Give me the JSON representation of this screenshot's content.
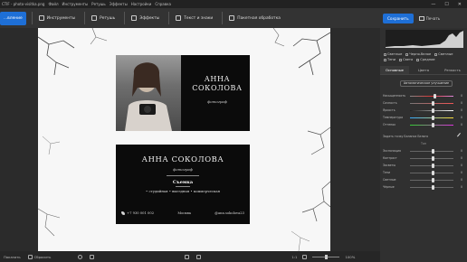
{
  "app": {
    "title": "CTIF - photo-visitka.png",
    "menus": [
      "Файл",
      "Инструменты",
      "Ретушь",
      "Эффекты",
      "Настройки",
      "Справка"
    ],
    "window_controls": [
      "—",
      "☐",
      "✕"
    ]
  },
  "toolbar": {
    "items": [
      {
        "label": "...вление",
        "icon": "adjust-icon",
        "active": true
      },
      {
        "label": "Инструменты",
        "icon": "tools-icon"
      },
      {
        "label": "Ретушь",
        "icon": "retouch-icon"
      },
      {
        "label": "Эффекты",
        "icon": "effects-icon"
      },
      {
        "label": "Текст и знаки",
        "icon": "text-icon"
      },
      {
        "label": "Пакетная обработка",
        "icon": "batch-icon"
      }
    ],
    "save_label": "Сохранить",
    "print_label": "Печать"
  },
  "cards": {
    "card1": {
      "name_line1": "АННА",
      "name_line2": "СОКОЛОВА",
      "role": "фотограф"
    },
    "card2": {
      "name": "АННА СОКОЛОВА",
      "role": "фотограф",
      "services_title": "Съемка",
      "services_list": "• студийная   • выездная   • коммерческая",
      "phone": "+7 930 001 002",
      "city": "Москва",
      "social": "@ann.sokolova23"
    }
  },
  "right_panel": {
    "checkboxes": [
      "Светлые",
      "Черно-белое",
      "Светлые"
    ],
    "checkboxes2": [
      "Тени",
      "Света",
      "Средние"
    ],
    "tabs": [
      "Основные",
      "Цвета",
      "Резкость"
    ],
    "active_tab": "Основные",
    "auto_button": "Автоматическое улучшение",
    "sliders": [
      {
        "label": "Насыщенность",
        "value": "0",
        "pos": 0.55,
        "gradient": "linear-gradient(90deg,#888,#d33,#d8d)"
      },
      {
        "label": "Сочность",
        "value": "0",
        "pos": 0.5,
        "gradient": "linear-gradient(90deg,#777,#e55)"
      },
      {
        "label": "Яркость",
        "value": "0",
        "pos": 0.5,
        "gradient": "linear-gradient(90deg,#222,#fff)"
      },
      {
        "label": "Температура",
        "value": "0",
        "pos": 0.5,
        "gradient": "linear-gradient(90deg,#3af,#fd3)"
      },
      {
        "label": "Оттенок",
        "value": "0",
        "pos": 0.5,
        "gradient": "linear-gradient(90deg,#3c3,#d3d)"
      }
    ],
    "bw_label": "Задать точку Баланса Белого",
    "tone_section": "Тон",
    "tone_sliders": [
      {
        "label": "Экспозиция",
        "value": "0",
        "pos": 0.5
      },
      {
        "label": "Контраст",
        "value": "0",
        "pos": 0.5
      },
      {
        "label": "Засветы",
        "value": "0",
        "pos": 0.5
      },
      {
        "label": "Тени",
        "value": "0",
        "pos": 0.5
      },
      {
        "label": "Светлые",
        "value": "0",
        "pos": 0.5
      },
      {
        "label": "Чёрные",
        "value": "0",
        "pos": 0.5
      }
    ]
  },
  "status": {
    "view_label": "Показать",
    "reset_label": "Сбросить",
    "zoom_fit": "1:1",
    "zoom_value": "100%",
    "zoom_pos": 0.45
  }
}
